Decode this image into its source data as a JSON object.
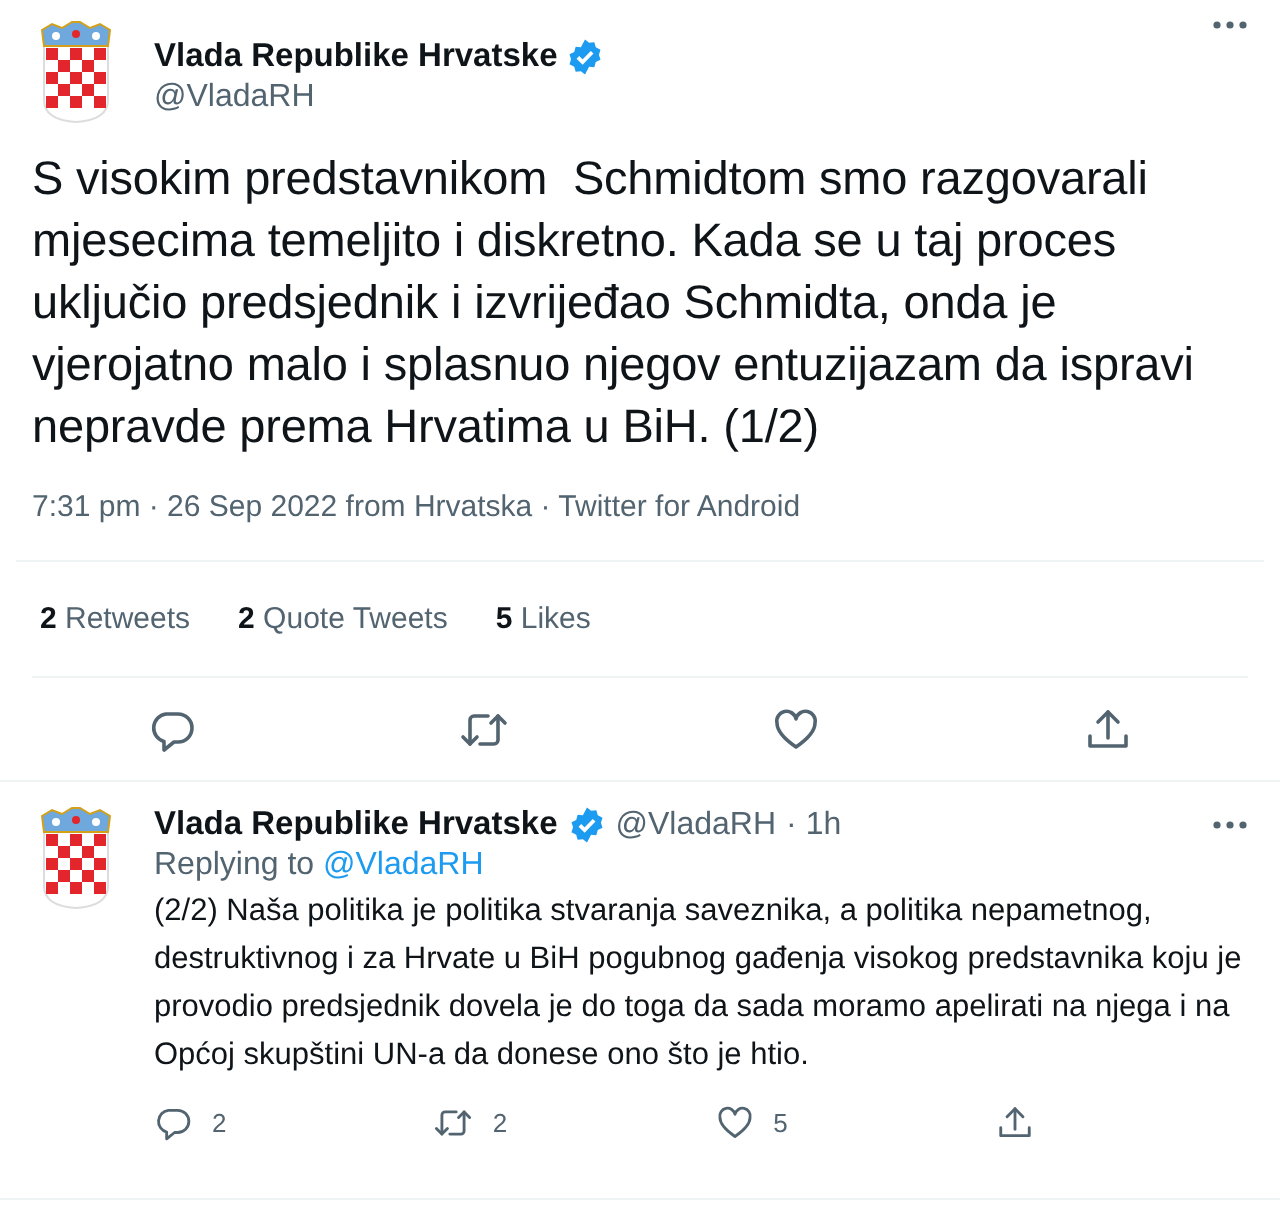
{
  "tweet": {
    "author": {
      "name": "Vlada Republike Hrvatske",
      "verified": true,
      "handle": "@VladaRH"
    },
    "text": "S visokim predstavnikom  Schmidtom smo razgovarali mjesecima temeljito i diskretno. Kada se u taj proces uključio predsjednik i izvrijeđao Schmidta, onda je vjerojatno malo i splasnuo njegov entuzijazam da ispravi nepravde prema Hrvatima u BiH. (1/2)",
    "meta": "7:31 pm · 26 Sep 2022 from Hrvatska · Twitter for Android",
    "stats": [
      {
        "count": "2",
        "label": "Retweets"
      },
      {
        "count": "2",
        "label": "Quote Tweets"
      },
      {
        "count": "5",
        "label": "Likes"
      }
    ],
    "actions": [
      {
        "kind": "reply"
      },
      {
        "kind": "retweet"
      },
      {
        "kind": "like"
      },
      {
        "kind": "share"
      }
    ]
  },
  "reply": {
    "author": {
      "name": "Vlada Republike Hrvatske",
      "verified": true,
      "handle": "@VladaRH"
    },
    "time": "· 1h",
    "replying_to": "Replying to",
    "replying_handle": "@VladaRH",
    "text": "(2/2) Naša politika je politika stvaranja saveznika, a politika nepametnog, destruktivnog i za Hrvate u BiH pogubnog gađenja visokog predstavnika koju je provodio predsjednik dovela je do toga da sada moramo apelirati na njega i na Općoj skupštini UN-a da donese ono što je htio.",
    "actions": [
      {
        "kind": "reply",
        "count": "2"
      },
      {
        "kind": "retweet",
        "count": "2"
      },
      {
        "kind": "like",
        "count": "5"
      },
      {
        "kind": "share"
      }
    ]
  }
}
